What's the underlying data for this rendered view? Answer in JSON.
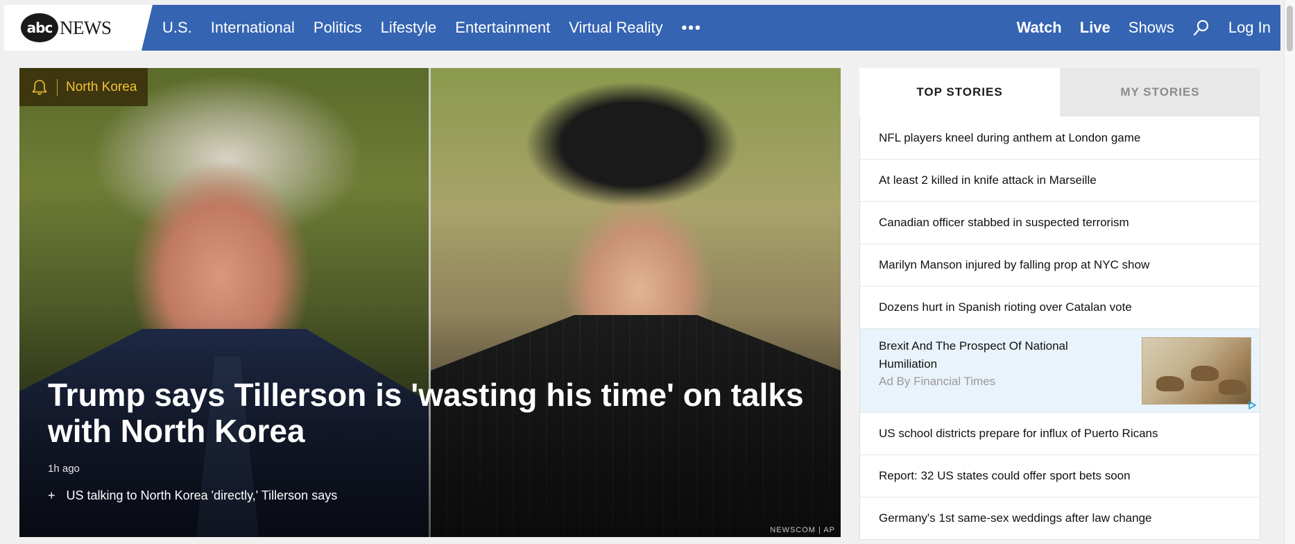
{
  "logo": {
    "mark": "abc",
    "word": "NEWS"
  },
  "nav": {
    "items": [
      "U.S.",
      "International",
      "Politics",
      "Lifestyle",
      "Entertainment",
      "Virtual Reality"
    ],
    "more": "•••",
    "right": {
      "watch": "Watch",
      "live": "Live",
      "shows": "Shows",
      "login": "Log In"
    }
  },
  "hero": {
    "tag": "North Korea",
    "headline": "Trump says Tillerson is 'wasting his time' on talks with North Korea",
    "timestamp": "1h ago",
    "related": "US talking to North Korea 'directly,' Tillerson says",
    "credit": "NEWSCOM | AP"
  },
  "tabs": {
    "top": "TOP STORIES",
    "mine": "MY STORIES"
  },
  "stories": [
    "NFL players kneel during anthem at London game",
    "At least 2 killed in knife attack in Marseille",
    "Canadian officer stabbed in suspected terrorism",
    "Marilyn Manson injured by falling prop at NYC show",
    "Dozens hurt in Spanish rioting over Catalan vote"
  ],
  "ad": {
    "title": "Brexit And The Prospect Of National Humiliation",
    "source": "Ad By Financial Times"
  },
  "stories_after": [
    "US school districts prepare for influx of Puerto Ricans",
    "Report: 32 US states could offer sport bets soon",
    "Germany's 1st same-sex weddings after law change"
  ],
  "colors": {
    "nav": "#3564b2",
    "tag_text": "#f5c232",
    "ad_bg": "#e9f3fb"
  }
}
